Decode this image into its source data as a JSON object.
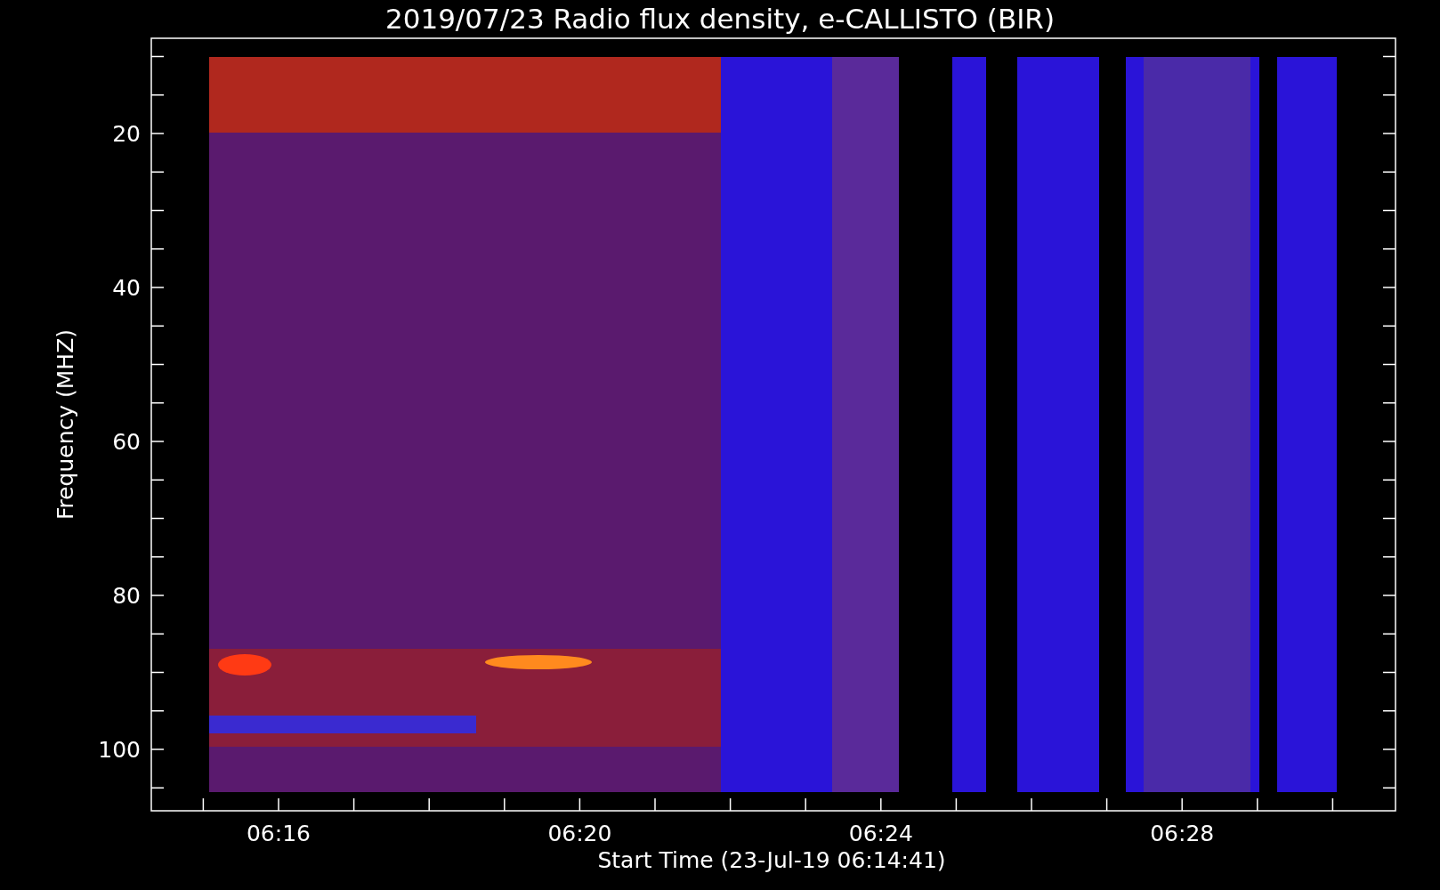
{
  "title": "2019/07/23  Radio flux density, e-CALLISTO (BIR)",
  "ylabel": "Frequency (MHZ)",
  "xlabel": "Start Time (23-Jul-19 06:14:41)",
  "yticks": [
    "20",
    "40",
    "60",
    "80",
    "100"
  ],
  "xticks": [
    "06:16",
    "06:20",
    "06:24",
    "06:28"
  ],
  "spectrogram": {
    "kind": "picture"
  }
}
